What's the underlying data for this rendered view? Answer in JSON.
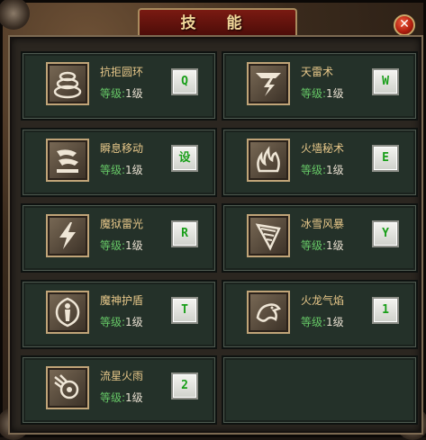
{
  "window": {
    "title": "技 能",
    "close_glyph": "✕"
  },
  "skills": [
    {
      "name": "抗拒圆环",
      "level_label": "等级:",
      "level_value": "1级",
      "key": "Q",
      "icon": "rings-icon"
    },
    {
      "name": "天雷术",
      "level_label": "等级:",
      "level_value": "1级",
      "key": "W",
      "icon": "lightning-strike-icon"
    },
    {
      "name": "瞬息移动",
      "level_label": "等级:",
      "level_value": "1级",
      "key": "设",
      "icon": "teleport-icon"
    },
    {
      "name": "火墙秘术",
      "level_label": "等级:",
      "level_value": "1级",
      "key": "E",
      "icon": "fire-wall-icon"
    },
    {
      "name": "魔狱雷光",
      "level_label": "等级:",
      "level_value": "1级",
      "key": "R",
      "icon": "thunder-bolt-icon"
    },
    {
      "name": "冰雪风暴",
      "level_label": "等级:",
      "level_value": "1级",
      "key": "Y",
      "icon": "ice-storm-icon"
    },
    {
      "name": "魔神护盾",
      "level_label": "等级:",
      "level_value": "1级",
      "key": "T",
      "icon": "magic-shield-icon"
    },
    {
      "name": "火龙气焰",
      "level_label": "等级:",
      "level_value": "1级",
      "key": "1",
      "icon": "fire-dragon-icon"
    },
    {
      "name": "流星火雨",
      "level_label": "等级:",
      "level_value": "1级",
      "key": "2",
      "icon": "meteor-shower-icon"
    }
  ]
}
